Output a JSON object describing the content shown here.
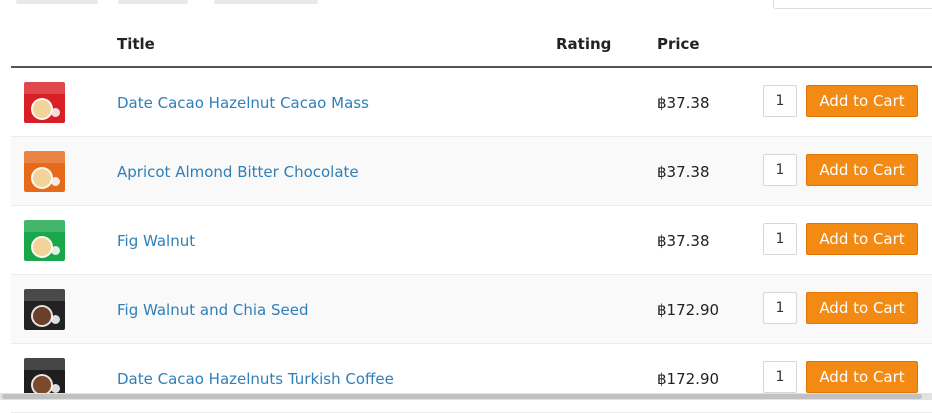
{
  "table": {
    "headers": {
      "title": "Title",
      "rating": "Rating",
      "price": "Price"
    },
    "add_to_cart_label": "Add to Cart",
    "rows": [
      {
        "title": "Date Cacao Hazelnut Cacao Mass",
        "price": "฿37.38",
        "quantity": "1",
        "thumb_color": "#d81f26",
        "thumb_icon": "date-cacao-hazelnut-package-icon"
      },
      {
        "title": "Apricot Almond Bitter Chocolate",
        "price": "฿37.38",
        "quantity": "1",
        "thumb_color": "#e56a1c",
        "thumb_icon": "apricot-almond-package-icon"
      },
      {
        "title": "Fig Walnut",
        "price": "฿37.38",
        "quantity": "1",
        "thumb_color": "#1aa64a",
        "thumb_icon": "fig-walnut-package-icon"
      },
      {
        "title": "Fig Walnut and Chia Seed",
        "price": "฿172.90",
        "quantity": "1",
        "thumb_color": "#222222",
        "thumb_icon": "fig-walnut-chia-package-icon"
      },
      {
        "title": "Date Cacao Hazelnuts Turkish Coffee",
        "price": "฿172.90",
        "quantity": "1",
        "thumb_color": "#1e1e1e",
        "thumb_icon": "date-cacao-coffee-package-icon"
      }
    ]
  },
  "colors": {
    "link": "#2f7fb8",
    "button": "#f28a14",
    "button_border": "#e27305"
  }
}
